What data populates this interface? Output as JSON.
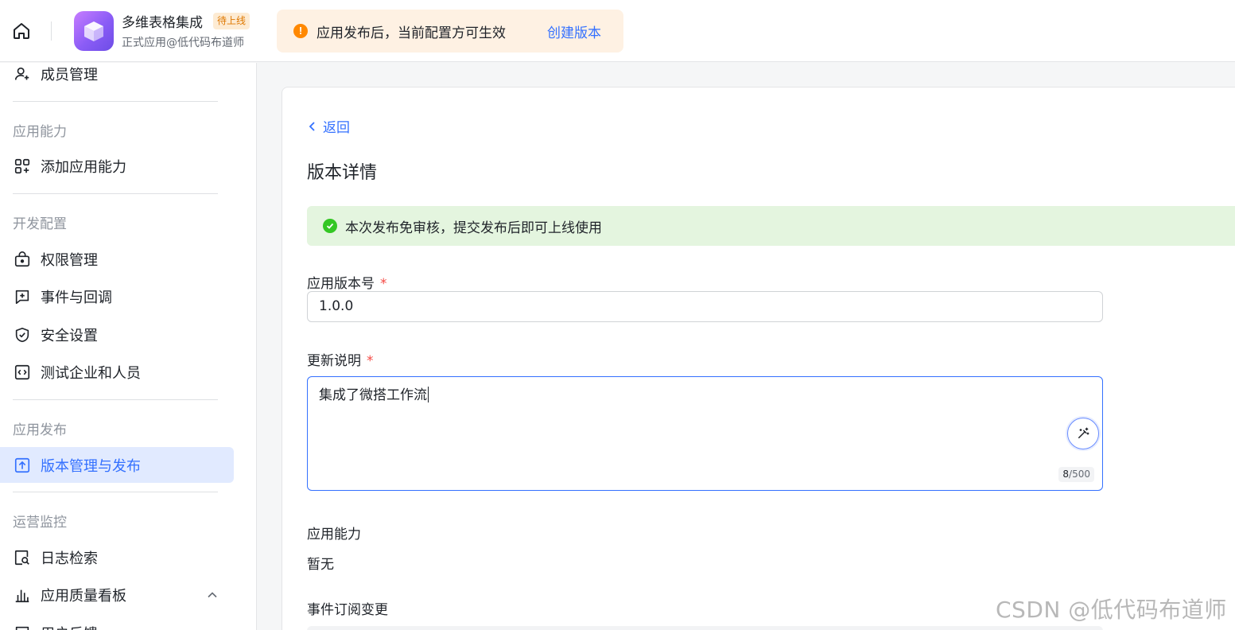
{
  "topbar": {
    "app_name": "多维表格集成",
    "status_tag": "待上线",
    "app_subtitle": "正式应用@低代码布道师",
    "notice_text": "应用发布后，当前配置方可生效",
    "notice_link": "创建版本",
    "notice_icon": "!"
  },
  "sidebar": {
    "items": [
      {
        "label": "成员管理",
        "icon": "person-add-icon"
      },
      {
        "label": "添加应用能力",
        "icon": "apps-add-icon"
      },
      {
        "label": "权限管理",
        "icon": "lock-bag-icon"
      },
      {
        "label": "事件与回调",
        "icon": "plus-square-icon"
      },
      {
        "label": "安全设置",
        "icon": "shield-check-icon"
      },
      {
        "label": "测试企业和人员",
        "icon": "code-square-icon"
      },
      {
        "label": "版本管理与发布",
        "icon": "upload-square-icon"
      },
      {
        "label": "日志检索",
        "icon": "search-doc-icon"
      },
      {
        "label": "应用质量看板",
        "icon": "bar-chart-icon"
      },
      {
        "label": "用户反馈",
        "icon": "feedback-icon"
      }
    ],
    "sections": [
      "应用能力",
      "开发配置",
      "应用发布",
      "运营监控"
    ],
    "active_item": "版本管理与发布"
  },
  "main": {
    "back_label": "返回",
    "title": "版本详情",
    "success_text": "本次发布免审核，提交发布后即可上线使用",
    "version_label": "应用版本号",
    "required_mark": "*",
    "version_value": "1.0.0",
    "notes_label": "更新说明",
    "notes_value": "集成了微搭工作流",
    "counter_current": "8",
    "counter_max": "/500",
    "capability_label": "应用能力",
    "capability_value": "暂无",
    "event_label": "事件订阅变更"
  },
  "watermark": "CSDN @低代码布道师",
  "colors": {
    "accent": "#3370ff",
    "warning": "#ff8800",
    "success": "#34c724",
    "active_bg": "#e1eaff"
  }
}
